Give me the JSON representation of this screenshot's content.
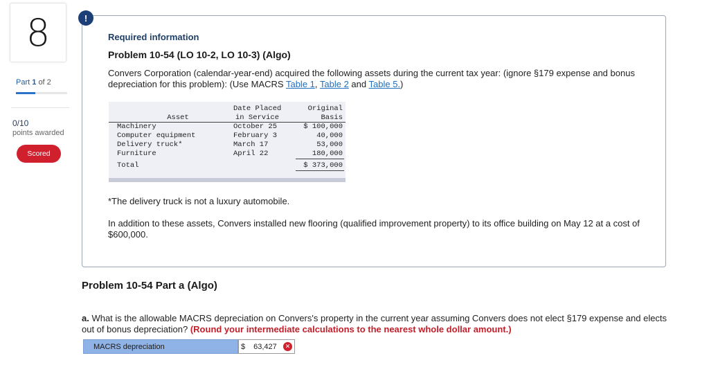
{
  "sidebar": {
    "question_number": "8",
    "part_prefix": "Part",
    "part_current": "1",
    "part_of": "of 2",
    "score": "0/10",
    "score_label": "points awarded",
    "scored_badge": "Scored"
  },
  "info": {
    "alert_glyph": "!",
    "heading": "Required information",
    "problem_title": "Problem 10-54 (LO 10-2, LO 10-3) (Algo)",
    "intro_text": "Convers Corporation (calendar-year-end) acquired the following assets during the current tax year: (ignore §179 expense and bonus depreciation for this problem): (Use MACRS ",
    "link_table1": "Table 1",
    "sep1": ", ",
    "link_table2": "Table 2",
    "sep2": " and ",
    "link_table5": "Table 5.",
    "intro_end": ")",
    "footnote": "*The delivery truck is not a luxury automobile.",
    "additional": "In addition to these assets, Convers installed new flooring (qualified improvement property) to its office building on May 12 at a cost of $600,000."
  },
  "asset_table": {
    "header_asset": "Asset",
    "header_date_1": "Date Placed",
    "header_date_2": "in Service",
    "header_basis_1": "Original",
    "header_basis_2": "Basis",
    "rows": [
      {
        "asset": "Machinery",
        "date": "October 25",
        "basis": "$ 100,000"
      },
      {
        "asset": "Computer equipment",
        "date": "February 3",
        "basis": "40,000"
      },
      {
        "asset": "Delivery truck*",
        "date": "March 17",
        "basis": "53,000"
      },
      {
        "asset": "Furniture",
        "date": "April 22",
        "basis": "180,000"
      }
    ],
    "total_label": "Total",
    "total_value": "$ 373,000"
  },
  "part_a": {
    "title": "Problem 10-54 Part a (Algo)",
    "question_label": "a.",
    "question_text": " What is the allowable MACRS depreciation on Convers's property in the current year assuming Convers does not elect §179 expense and elects out of bonus depreciation? ",
    "instruction": "(Round your intermediate calculations to the nearest whole dollar amount.)",
    "answer_label": "MACRS depreciation",
    "answer_currency": "$",
    "answer_value": "63,427",
    "answer_status": "incorrect-icon"
  }
}
